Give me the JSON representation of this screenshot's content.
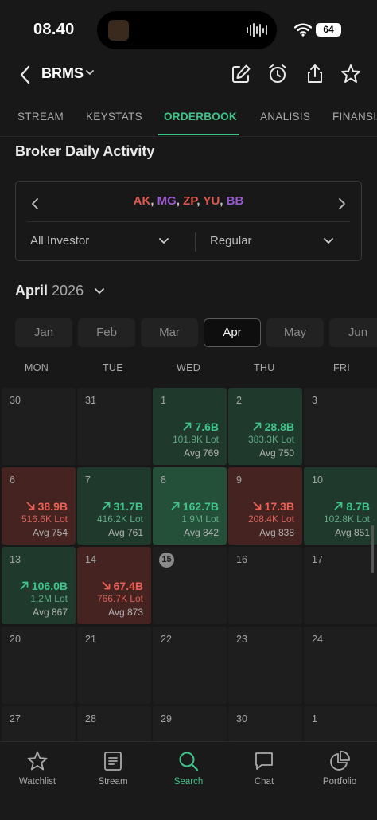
{
  "status": {
    "time": "08.40",
    "battery": "64"
  },
  "header": {
    "ticker": "BRMS"
  },
  "tabs": [
    {
      "label": "STREAM",
      "active": false
    },
    {
      "label": "KEYSTATS",
      "active": false
    },
    {
      "label": "ORDERBOOK",
      "active": true
    },
    {
      "label": "ANALISIS",
      "active": false
    },
    {
      "label": "FINANSIA",
      "active": false
    }
  ],
  "section_title": "Broker Daily Activity",
  "filter": {
    "brokers": [
      "AK",
      "MG",
      "ZP",
      "YU",
      "BB"
    ],
    "investor": "All Investor",
    "market": "Regular"
  },
  "calendar": {
    "month": "April",
    "year": "2026",
    "months": [
      "Jan",
      "Feb",
      "Mar",
      "Apr",
      "May",
      "Jun"
    ],
    "active_month": "Apr",
    "weekdays": [
      "MON",
      "TUE",
      "WED",
      "THU",
      "FRI"
    ],
    "weeks": [
      [
        {
          "day": "30"
        },
        {
          "day": "31"
        },
        {
          "day": "1",
          "trend": "up",
          "value": "7.6B",
          "lot": "101.9K Lot",
          "avg": "Avg 769"
        },
        {
          "day": "2",
          "trend": "up",
          "value": "28.8B",
          "lot": "383.3K Lot",
          "avg": "Avg 750"
        },
        {
          "day": "3"
        }
      ],
      [
        {
          "day": "6",
          "trend": "down",
          "value": "38.9B",
          "lot": "516.6K Lot",
          "avg": "Avg 754"
        },
        {
          "day": "7",
          "trend": "up",
          "value": "31.7B",
          "lot": "416.2K Lot",
          "avg": "Avg 761"
        },
        {
          "day": "8",
          "trend": "up",
          "strong": true,
          "value": "162.7B",
          "lot": "1.9M Lot",
          "avg": "Avg 842"
        },
        {
          "day": "9",
          "trend": "down",
          "value": "17.3B",
          "lot": "208.4K Lot",
          "avg": "Avg 838"
        },
        {
          "day": "10",
          "trend": "up",
          "value": "8.7B",
          "lot": "102.8K Lot",
          "avg": "Avg 851"
        }
      ],
      [
        {
          "day": "13",
          "trend": "up",
          "value": "106.0B",
          "lot": "1.2M Lot",
          "avg": "Avg 867"
        },
        {
          "day": "14",
          "trend": "down",
          "value": "67.4B",
          "lot": "766.7K Lot",
          "avg": "Avg 873"
        },
        {
          "day": "15",
          "today": true
        },
        {
          "day": "16"
        },
        {
          "day": "17"
        }
      ],
      [
        {
          "day": "20"
        },
        {
          "day": "21"
        },
        {
          "day": "22"
        },
        {
          "day": "23"
        },
        {
          "day": "24"
        }
      ],
      [
        {
          "day": "27"
        },
        {
          "day": "28"
        },
        {
          "day": "29"
        },
        {
          "day": "30"
        },
        {
          "day": "1"
        }
      ]
    ]
  },
  "bottom_nav": [
    {
      "label": "Watchlist",
      "icon": "star-icon",
      "active": false
    },
    {
      "label": "Stream",
      "icon": "stream-icon",
      "active": false
    },
    {
      "label": "Search",
      "icon": "search-icon",
      "active": true
    },
    {
      "label": "Chat",
      "icon": "chat-icon",
      "active": false
    },
    {
      "label": "Portfolio",
      "icon": "pie-chart-icon",
      "active": false
    }
  ],
  "colors": {
    "accent": "#3fc48a",
    "down": "#ec5f55",
    "broker_red": "#e0574f",
    "broker_purple": "#9b59d0"
  }
}
